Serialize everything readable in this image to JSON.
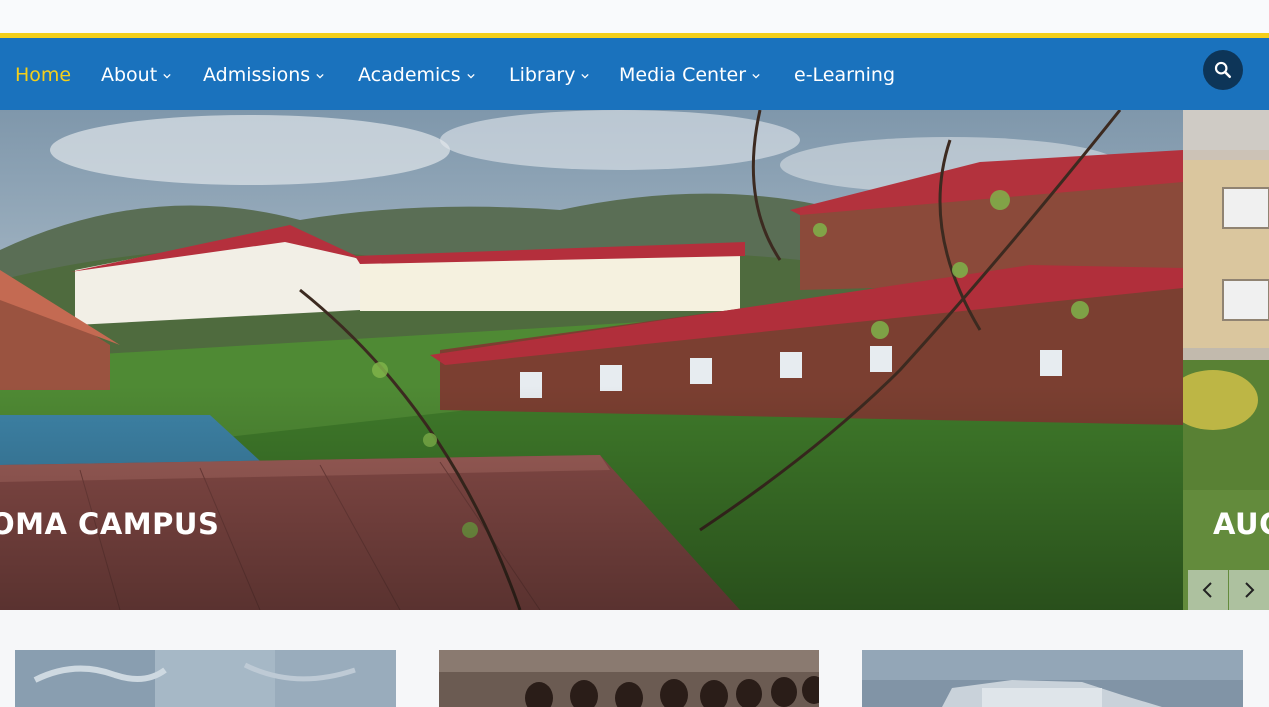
{
  "nav": {
    "items": [
      {
        "label": "Home",
        "active": true,
        "dropdown": false
      },
      {
        "label": "About",
        "active": false,
        "dropdown": true
      },
      {
        "label": "Admissions",
        "active": false,
        "dropdown": true
      },
      {
        "label": "Academics",
        "active": false,
        "dropdown": true
      },
      {
        "label": "Library",
        "active": false,
        "dropdown": true
      },
      {
        "label": "Media Center",
        "active": false,
        "dropdown": true
      },
      {
        "label": "e-Learning",
        "active": false,
        "dropdown": false
      }
    ],
    "search_icon": "search-icon"
  },
  "slider": {
    "slides": [
      {
        "caption": "OMA CAMPUS"
      },
      {
        "caption": "AUC"
      }
    ],
    "prev_icon": "chevron-left-icon",
    "next_icon": "chevron-right-icon"
  },
  "colors": {
    "accent_yellow": "#f4cf1a",
    "nav_blue": "#1a72bd",
    "search_bg": "#0d3558"
  }
}
